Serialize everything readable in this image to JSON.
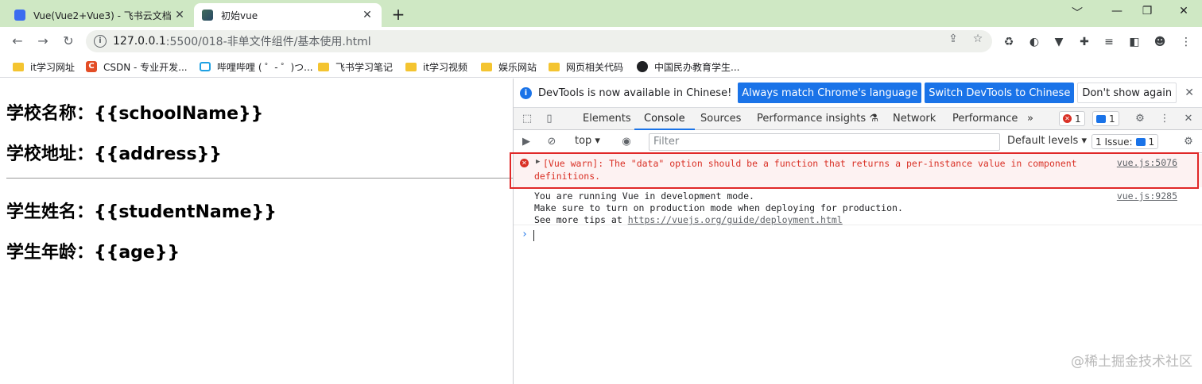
{
  "browser": {
    "tabs": [
      {
        "label": "Vue(Vue2+Vue3) - 飞书云文档",
        "close": "✕"
      },
      {
        "label": "初始vue",
        "close": "✕"
      }
    ],
    "new_tab": "+",
    "window": {
      "minimize": "﹀",
      "min": "—",
      "restore": "❐",
      "close": "✕"
    }
  },
  "toolbar": {
    "back": "←",
    "forward": "→",
    "reload": "↻",
    "url_host": "127.0.0.1",
    "url_path": ":5500/018-非单文件组件/基本使用.html"
  },
  "bookmarks": [
    {
      "label": "it学习网址",
      "icon": "folder"
    },
    {
      "label": "CSDN - 专业开发...",
      "icon": "csdn"
    },
    {
      "label": "哔哩哔哩 ( ゜- ゜)つ...",
      "icon": "bilibili"
    },
    {
      "label": "飞书学习笔记",
      "icon": "folder"
    },
    {
      "label": "it学习视频",
      "icon": "folder"
    },
    {
      "label": "娱乐网站",
      "icon": "folder"
    },
    {
      "label": "网页相关代码",
      "icon": "folder"
    },
    {
      "label": "中国民办教育学生...",
      "icon": "globe"
    }
  ],
  "page": {
    "school_name": "学校名称：{{schoolName}}",
    "school_address": "学校地址：{{address}}",
    "student_name": "学生姓名：{{studentName}}",
    "student_age": "学生年龄：{{age}}"
  },
  "devtools": {
    "infobar": {
      "message": "DevTools is now available in Chinese!",
      "match_button": "Always match Chrome's language",
      "switch_button": "Switch DevTools to Chinese",
      "dismiss_button": "Don't show again"
    },
    "tabs": [
      "Elements",
      "Console",
      "Sources",
      "Performance insights ⚗",
      "Network",
      "Performance",
      "»"
    ],
    "active_tab": "Console",
    "error_count": "1",
    "message_count": "1",
    "context": "top ▾",
    "filter_placeholder": "Filter",
    "levels": "Default levels ▾",
    "issues": "1 Issue:",
    "issues_count": "1",
    "console": {
      "error_line1": "[Vue warn]: The \"data\" option should be a function that returns a per-instance value in component",
      "error_line2": "definitions.",
      "error_source": "vue.js:5076",
      "log_line1": "You are running Vue in development mode.",
      "log_line2": "Make sure to turn on production mode when deploying for production.",
      "log_line3_prefix": "See more tips at ",
      "log_line3_link": "https://vuejs.org/guide/deployment.html",
      "log_source": "vue.js:9285",
      "prompt": "›"
    }
  },
  "watermark": "@稀土掘金技术社区"
}
